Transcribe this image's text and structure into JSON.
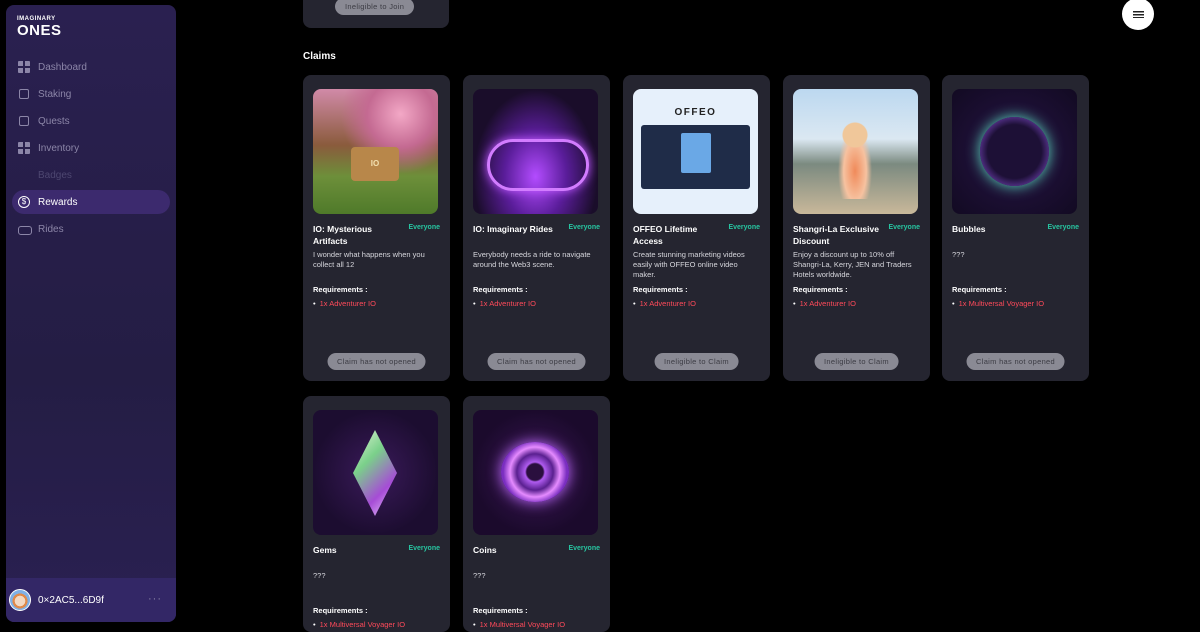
{
  "brand": {
    "line1": "IMAGINARY",
    "line2": "ONES"
  },
  "nav": [
    {
      "label": "Dashboard",
      "icon": "dashboard-icon"
    },
    {
      "label": "Staking",
      "icon": "staking-icon"
    },
    {
      "label": "Quests",
      "icon": "quests-icon"
    },
    {
      "label": "Inventory",
      "icon": "inventory-icon"
    },
    {
      "label": "Badges",
      "icon": "badges-icon"
    },
    {
      "label": "Rewards",
      "icon": "rewards-icon"
    },
    {
      "label": "Rides",
      "icon": "rides-icon"
    }
  ],
  "active_nav": "Rewards",
  "user": {
    "address": "0×2AC5...6D9f",
    "more": "···"
  },
  "top_card": {
    "button": "Ineligible to Join"
  },
  "section_title": "Claims",
  "cards": [
    {
      "name": "IO: Mysterious Artifacts",
      "tag": "Everyone",
      "desc": "I wonder what happens when you collect all 12",
      "req_heading": "Requirements :",
      "requirement": "1x Adventurer IO",
      "button": "Claim has not opened"
    },
    {
      "name": "IO: Imaginary Rides",
      "tag": "Everyone",
      "desc": "Everybody needs a ride to navigate around the Web3 scene.",
      "req_heading": "Requirements :",
      "requirement": "1x Adventurer IO",
      "button": "Claim has not opened"
    },
    {
      "name": "OFFEO Lifetime Access",
      "tag": "Everyone",
      "desc": "Create stunning marketing videos easily with OFFEO online video maker.",
      "req_heading": "Requirements :",
      "requirement": "1x Adventurer IO",
      "button": "Ineligible to Claim",
      "image_title": "OFFEO"
    },
    {
      "name": "Shangri-La Exclusive Discount",
      "tag": "Everyone",
      "desc": "Enjoy a discount up to 10% off Shangri-La, Kerry, JEN and Traders Hotels worldwide.",
      "req_heading": "Requirements :",
      "requirement": "1x Adventurer IO",
      "button": "Ineligible to Claim"
    },
    {
      "name": "Bubbles",
      "tag": "Everyone",
      "desc": "???",
      "req_heading": "Requirements :",
      "requirement": "1x Multiversal Voyager IO",
      "button": "Claim has not opened"
    },
    {
      "name": "Gems",
      "tag": "Everyone",
      "desc": "???",
      "req_heading": "Requirements :",
      "requirement": "1x Multiversal Voyager IO",
      "button": ""
    },
    {
      "name": "Coins",
      "tag": "Everyone",
      "desc": "???",
      "req_heading": "Requirements :",
      "requirement": "1x Multiversal Voyager IO",
      "button": ""
    }
  ]
}
